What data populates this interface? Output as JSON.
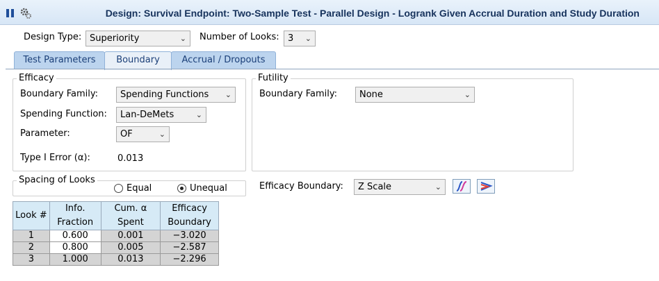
{
  "window": {
    "title": "Design: Survival Endpoint: Two-Sample Test - Parallel Design - Logrank Given Accrual Duration and Study Duration",
    "icons": [
      "pause-icon",
      "gears-icon"
    ]
  },
  "design": {
    "design_type_label": "Design Type:",
    "design_type_value": "Superiority",
    "looks_label": "Number of Looks:",
    "looks_value": "3"
  },
  "tabs": [
    {
      "label": "Test Parameters",
      "active": false
    },
    {
      "label": "Boundary",
      "active": true
    },
    {
      "label": "Accrual / Dropouts",
      "active": false
    }
  ],
  "efficacy": {
    "title": "Efficacy",
    "boundary_family_label": "Boundary Family:",
    "boundary_family_value": "Spending Functions",
    "spending_function_label": "Spending Function:",
    "spending_function_value": "Lan-DeMets",
    "parameter_label": "Parameter:",
    "parameter_value": "OF",
    "type1_label": "Type I Error (α):",
    "type1_value": "0.013"
  },
  "futility": {
    "title": "Futility",
    "boundary_family_label": "Boundary Family:",
    "boundary_family_value": "None"
  },
  "spacing": {
    "title": "Spacing of Looks",
    "equal_label": "Equal",
    "unequal_label": "Unequal",
    "selected": "Unequal"
  },
  "efficacy_boundary": {
    "label": "Efficacy Boundary:",
    "value": "Z Scale",
    "icons": [
      "boundary-chart-icon",
      "error-spending-chart-icon"
    ]
  },
  "table": {
    "headers": [
      "Look #",
      "Info.\nFraction",
      "Cum. α\nSpent",
      "Efficacy\nBoundary"
    ],
    "header_lines": [
      [
        "Look #"
      ],
      [
        "Info.",
        "Fraction"
      ],
      [
        "Cum. α",
        "Spent"
      ],
      [
        "Efficacy",
        "Boundary"
      ]
    ],
    "rows": [
      [
        "1",
        "0.600",
        "0.001",
        "−3.020"
      ],
      [
        "2",
        "0.800",
        "0.005",
        "−2.587"
      ],
      [
        "3",
        "1.000",
        "0.013",
        "−2.296"
      ]
    ]
  }
}
